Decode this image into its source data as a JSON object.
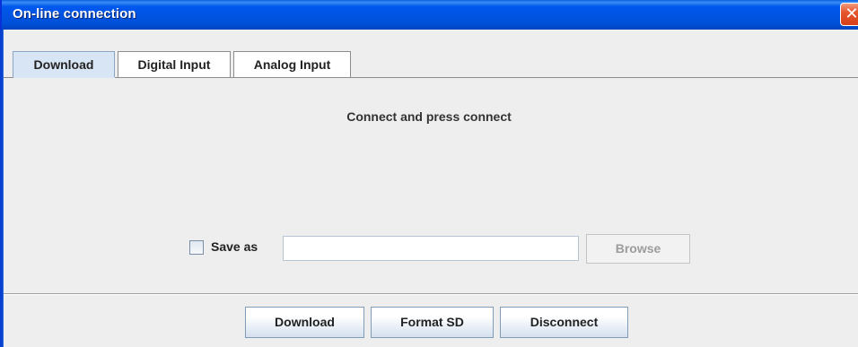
{
  "window": {
    "title": "On-line connection",
    "close_glyph": "✕"
  },
  "tabs": [
    {
      "label": "Download",
      "active": true
    },
    {
      "label": "Digital Input",
      "active": false
    },
    {
      "label": "Analog Input",
      "active": false
    }
  ],
  "main": {
    "message": "Connect and press connect",
    "save": {
      "checkbox_checked": false,
      "label": "Save as",
      "path_value": "",
      "browse_label": "Browse",
      "browse_enabled": false
    }
  },
  "footer": {
    "buttons": [
      {
        "label": "Download"
      },
      {
        "label": "Format SD"
      },
      {
        "label": "Disconnect"
      }
    ]
  },
  "colors": {
    "titlebar": "#0053e0",
    "close_button": "#e5562d",
    "active_tab": "#d8e5f4",
    "window_bg": "#eeeeee"
  }
}
